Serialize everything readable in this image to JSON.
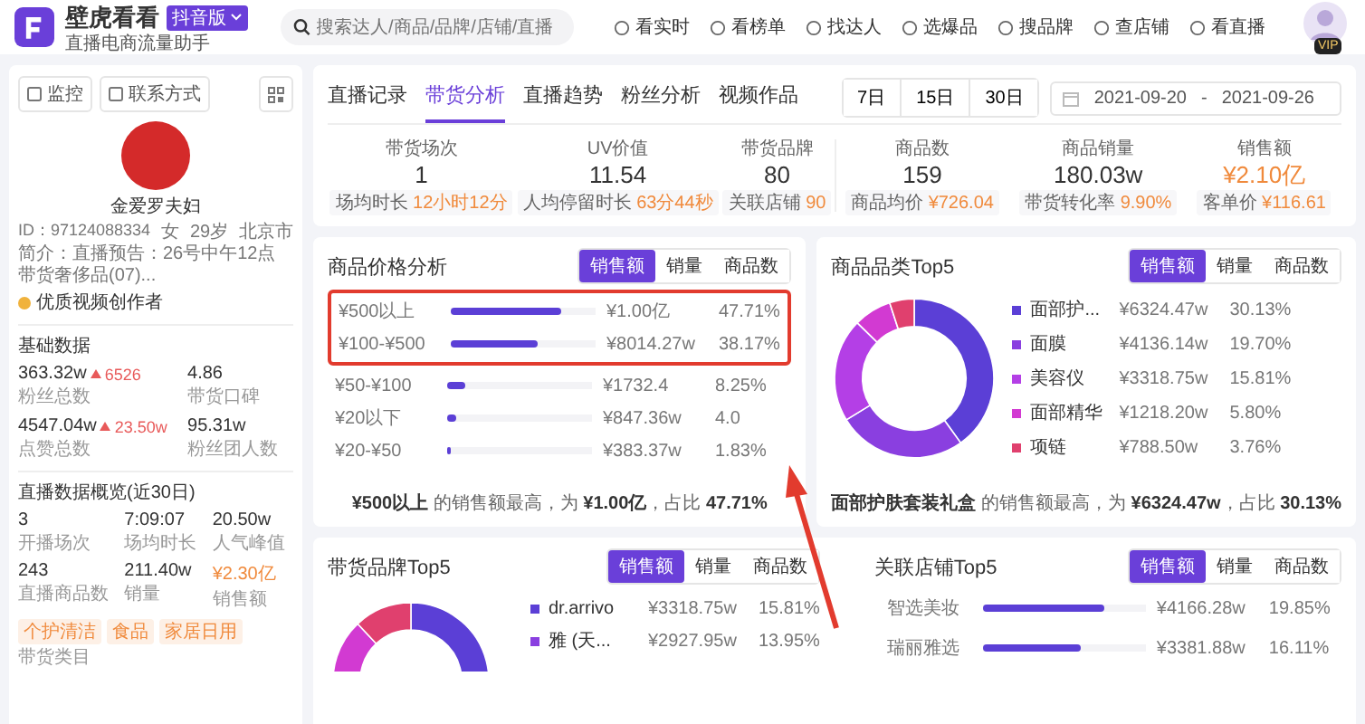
{
  "header": {
    "title": "壁虎看看",
    "edition": "抖音版",
    "subtitle": "直播电商流量助手",
    "search": {
      "placeholder": "搜索达人/商品/品牌/店铺/直播"
    },
    "nav": [
      {
        "label": "看实时"
      },
      {
        "label": "看榜单"
      },
      {
        "label": "找达人"
      },
      {
        "label": "选爆品"
      },
      {
        "label": "搜品牌"
      },
      {
        "label": "查店铺"
      },
      {
        "label": "看直播"
      }
    ],
    "vip": "VIP"
  },
  "profile": {
    "actions": [
      "监控",
      "联系方式"
    ],
    "name": "金爱罗夫妇",
    "meta": [
      "ID：97124088334",
      "女",
      "29岁",
      "北京市"
    ],
    "intro": "简介：直播预告：26号中午12点带货奢侈品(07)...",
    "badge": "优质视频创作者"
  },
  "basic": {
    "title": "基础数据",
    "stats": [
      {
        "value": "363.32w",
        "delta": "6526",
        "label": "粉丝总数"
      },
      {
        "value": "4.86",
        "label": "带货口碑"
      },
      {
        "value": "4547.04w",
        "delta": "23.50w",
        "label": "点赞总数"
      },
      {
        "value": "95.31w",
        "label": "粉丝团人数"
      }
    ]
  },
  "live": {
    "title": "直播数据概览(近30日)",
    "stats": [
      {
        "value": "3",
        "label": "开播场次",
        "highlight": false
      },
      {
        "value": "7:09:07",
        "label": "场均时长",
        "highlight": false
      },
      {
        "value": "20.50w",
        "label": "人气峰值",
        "highlight": false
      },
      {
        "value": "243",
        "label": "直播商品数",
        "highlight": false
      },
      {
        "value": "211.40w",
        "label": "销量",
        "highlight": false
      },
      {
        "value": "¥2.30亿",
        "label": "销售额",
        "highlight": true
      }
    ],
    "tags": [
      "个护清洁",
      "食品",
      "家居日用"
    ],
    "tags_label": "带货类目"
  },
  "tabs": [
    {
      "label": "直播记录",
      "selected": false
    },
    {
      "label": "带货分析",
      "selected": true
    },
    {
      "label": "直播趋势",
      "selected": false
    },
    {
      "label": "粉丝分析",
      "selected": false
    },
    {
      "label": "视频作品",
      "selected": false
    }
  ],
  "ranges": [
    "7日",
    "15日",
    "30日"
  ],
  "date_range": {
    "start": "2021-09-20",
    "separator": "-",
    "end": "2021-09-26"
  },
  "summary": [
    {
      "stats": [
        {
          "label": "带货场次",
          "value": "1",
          "sub_label": "场均时长",
          "sub_value": "12小时12分",
          "highlight": false
        },
        {
          "label": "UV价值",
          "value": "11.54",
          "sub_label": "人均停留时长",
          "sub_value": "63分44秒",
          "highlight": false
        },
        {
          "label": "带货品牌",
          "value": "80",
          "sub_label": "关联店铺",
          "sub_value": "90",
          "highlight": false
        }
      ]
    },
    {
      "stats": [
        {
          "label": "商品数",
          "value": "159",
          "sub_label": "商品均价",
          "sub_value": "¥726.04",
          "highlight": false
        },
        {
          "label": "商品销量",
          "value": "180.03w",
          "sub_label": "带货转化率",
          "sub_value": "9.90%",
          "highlight": false
        },
        {
          "label": "销售额",
          "value": "¥2.10亿",
          "sub_label": "客单价",
          "sub_value": "¥116.61",
          "highlight": true
        }
      ]
    }
  ],
  "price_analysis": {
    "title": "商品价格分析",
    "metrics": [
      {
        "label": "销售额",
        "selected": true
      },
      {
        "label": "销量",
        "selected": false
      },
      {
        "label": "商品数",
        "selected": false
      }
    ],
    "rows": [
      {
        "range": "¥500以上",
        "level": 0.76,
        "amount": "¥1.00亿",
        "share": "47.71%",
        "highlight": true
      },
      {
        "range": "¥100-¥500",
        "level": 0.6,
        "amount": "¥8014.27w",
        "share": "38.17%",
        "highlight": true
      },
      {
        "range": "¥50-¥100",
        "level": 0.13,
        "amount": "¥1732.4",
        "share": "8.25%",
        "highlight": false
      },
      {
        "range": "¥20以下",
        "level": 0.06,
        "amount": "¥847.36w",
        "share": "4.0",
        "highlight": false
      },
      {
        "range": "¥20-¥50",
        "level": 0.03,
        "amount": "¥383.37w",
        "share": "1.83%",
        "highlight": false
      }
    ],
    "summary": "**¥500以上** 的销售额最高，为 **¥1.00亿**，占比 **47.71%**"
  },
  "category": {
    "title": "商品品类Top5",
    "metrics": [
      {
        "label": "销售额",
        "selected": true
      },
      {
        "label": "销量",
        "selected": false
      },
      {
        "label": "商品数",
        "selected": false
      }
    ],
    "items": [
      {
        "amount": "¥6324.47w",
        "share": "30.13%",
        "color": "#5b3fd6"
      },
      {
        "amount": "¥4136.14w",
        "share": "19.70%",
        "color": "#8a3fe0"
      },
      {
        "amount": "¥3318.75w",
        "share": "15.81%",
        "color": "#b43fe6"
      },
      {
        "amount": "¥1218.20w",
        "share": "5.80%",
        "color": "#d23ad2"
      },
      {
        "amount": "¥788.50w",
        "share": "3.76%",
        "color": "#e0406e"
      }
    ],
    "chart_data": {
      "type": "donut",
      "categories": [
        "面部护...",
        "面膜",
        "美容仪",
        "面部精华",
        "项链"
      ],
      "series": [
        {
          "values": [
            40.08,
            26.19,
            21.02,
            7.71,
            5.0
          ]
        }
      ]
    },
    "summary": "**面部护肤套装礼盒** 的销售额最高，为 **¥6324.47w**，占比 **30.13%**"
  },
  "brand": {
    "title": "带货品牌Top5",
    "metrics": [
      {
        "label": "销售额",
        "selected": true
      },
      {
        "label": "销量",
        "selected": false
      },
      {
        "label": "商品数",
        "selected": false
      }
    ],
    "items": [
      {
        "name": "dr.arrivo",
        "amount": "¥3318.75w",
        "share": "15.81%",
        "color": "#5b3fd6"
      },
      {
        "name": "雅 (天...",
        "amount": "¥2927.95w",
        "share": "13.95%",
        "color": "#8a3fe0"
      }
    ]
  },
  "store": {
    "title": "关联店铺Top5",
    "metrics": [
      {
        "label": "销售额",
        "selected": true
      },
      {
        "label": "销量",
        "selected": false
      },
      {
        "label": "商品数",
        "selected": false
      }
    ],
    "rows": [
      {
        "name": "智选美妆",
        "level": 0.75,
        "amount": "¥4166.28w",
        "share": "19.85%"
      },
      {
        "name": "瑞丽雅选",
        "level": 0.6,
        "amount": "¥3381.88w",
        "share": "16.11%"
      }
    ]
  }
}
